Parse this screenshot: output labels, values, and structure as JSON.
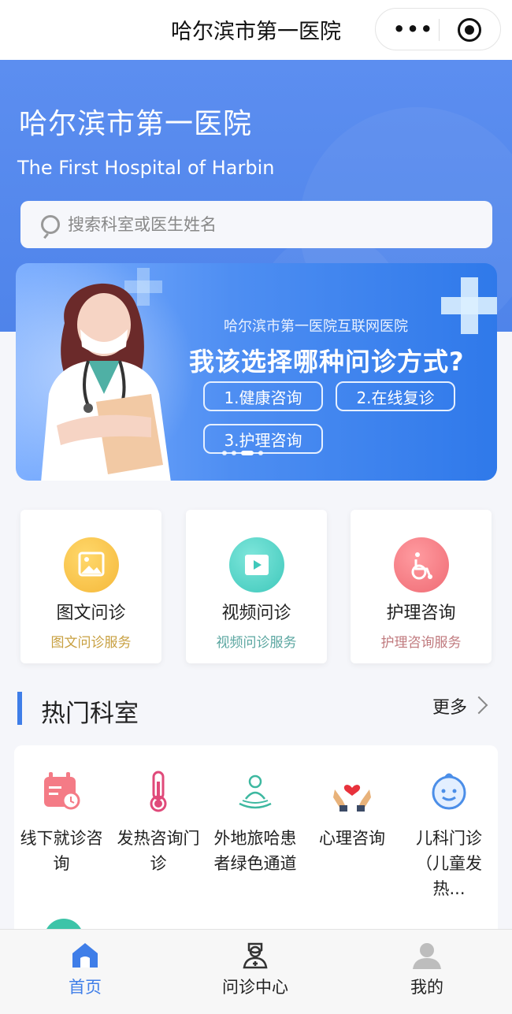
{
  "topbar": {
    "title": "哈尔滨市第一医院",
    "more_icon": "ellipsis-icon",
    "close_icon": "target-icon"
  },
  "hero": {
    "name_cn": "哈尔滨市第一医院",
    "name_en": "The First Hospital of Harbin"
  },
  "search": {
    "placeholder": "搜索科室或医生姓名"
  },
  "banner": {
    "subtitle": "哈尔滨市第一医院互联网医院",
    "headline": "我该选择哪种问诊方式?",
    "options": [
      "1.健康咨询",
      "2.在线复诊",
      "3.护理咨询"
    ],
    "slide_count": 4,
    "active_slide": 2
  },
  "services": [
    {
      "title": "图文问诊",
      "sub": "图文问诊服务",
      "icon": "image-icon",
      "color": "#f7c84a",
      "sub_color": "#c8a041"
    },
    {
      "title": "视频问诊",
      "sub": "视频问诊服务",
      "icon": "video-icon",
      "color": "#4fd1c5",
      "sub_color": "#5aa6a0"
    },
    {
      "title": "护理咨询",
      "sub": "护理咨询服务",
      "icon": "wheelchair-icon",
      "color": "#f47a82",
      "sub_color": "#c07a7e"
    }
  ],
  "section": {
    "title": "热门科室",
    "more": "更多"
  },
  "departments": [
    {
      "label": "线下就诊咨询",
      "icon": "calendar-icon"
    },
    {
      "label": "发热咨询门诊",
      "icon": "thermometer-icon"
    },
    {
      "label": "外地旅哈患者绿色通道",
      "icon": "patient-care-icon"
    },
    {
      "label": "心理咨询",
      "icon": "heart-hands-icon"
    },
    {
      "label": "儿科门诊（儿童发热...",
      "icon": "baby-face-icon"
    }
  ],
  "tabbar": {
    "items": [
      {
        "label": "首页",
        "icon": "home-icon",
        "active": true
      },
      {
        "label": "问诊中心",
        "icon": "doctor-icon",
        "active": false
      },
      {
        "label": "我的",
        "icon": "user-icon",
        "active": false
      }
    ],
    "active_color": "#3f7ee8",
    "inactive_color": "#222222"
  }
}
